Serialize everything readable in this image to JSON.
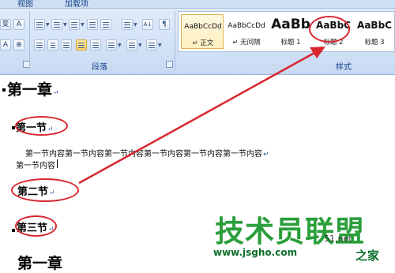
{
  "ribbon": {
    "tabs": [
      "视图",
      "加载项"
    ],
    "font_group": {
      "row1_glyphs": [
        "变",
        "A"
      ],
      "row2_glyphs": [
        "A",
        "⊕"
      ]
    },
    "paragraph_group": {
      "label": "段落",
      "sort_glyph": "A↓",
      "pilcrow_glyph": "¶"
    },
    "styles_group": {
      "label": "样式",
      "gallery": [
        {
          "sample": "AaBbCcDd",
          "name": "↵ 正文",
          "selected": true
        },
        {
          "sample": "AaBbCcDd",
          "name": "↵ 无间隔",
          "selected": false
        },
        {
          "sample": "AaBb",
          "name": "标题 1",
          "selected": false
        },
        {
          "sample": "AaBbC",
          "name": "标题 2",
          "selected": false
        },
        {
          "sample": "AaBbC",
          "name": "标题 3",
          "selected": false
        }
      ]
    }
  },
  "document": {
    "chapter1": "第一章",
    "section1": "第一节",
    "body_line1": "第一节内容第一节内容第一节内容第一节内容第一节内容第一节内容",
    "body_line2": "第一节内容",
    "section2": "第二节",
    "section3": "第三节",
    "chapter2": "第一章",
    "para_mark": "↵"
  },
  "watermark": {
    "main": "技术员联盟",
    "url": "www.jsgho.com",
    "side": "51.net",
    "tail": "之家"
  },
  "colors": {
    "annotation_red": "#d9262e",
    "ribbon_bg": "#d3e2f6",
    "watermark_green": "#2a9e3a"
  }
}
